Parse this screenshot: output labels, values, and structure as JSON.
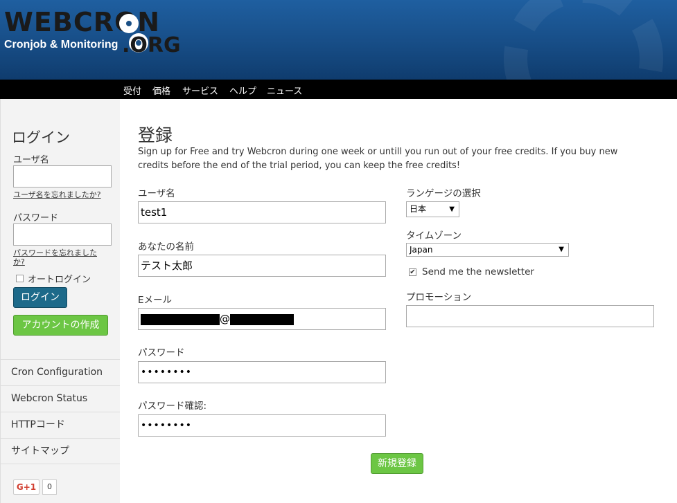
{
  "header": {
    "logo_main": "WEBCRON",
    "logo_sub": "Cronjob & Monitoring",
    "logo_org": ".ORG"
  },
  "nav": [
    "受付",
    "価格",
    "サービス",
    "ヘルプ",
    "ニュース"
  ],
  "sidebar": {
    "title": "ログイン",
    "username_label": "ユーザ名",
    "forgot_username": "ユーザ名を忘れましたか?",
    "password_label": "パスワード",
    "forgot_password": "パスワードを忘れましたか?",
    "autologin_label": "オートログイン",
    "login_button": "ログイン",
    "create_account_button": "アカウントの作成",
    "menu": [
      "Cron Configuration",
      "Webcron Status",
      "HTTPコード",
      "サイトマップ"
    ],
    "gplus_label": "G+1",
    "gplus_count": "0"
  },
  "main": {
    "title": "登録",
    "intro": "Sign up for Free and try Webcron during one week or untill you run out of your free credits. If you buy new credits before the end of the trial period, you can keep the free credits!",
    "username_label": "ユーザ名",
    "username_value": "test1",
    "name_label": "あなたの名前",
    "name_value": "テスト太郎",
    "email_label": "Eメール",
    "email_at": "@",
    "password_label": "パスワード",
    "password_value": "••••••••",
    "password_confirm_label": "パスワード確認:",
    "password_confirm_value": "••••••••",
    "language_label": "ランゲージの選択",
    "language_value": "日本",
    "timezone_label": "タイムゾーン",
    "timezone_value": "Japan",
    "newsletter_label": "Send me the newsletter",
    "promotion_label": "プロモーション",
    "promotion_value": "",
    "register_button": "新規登録"
  }
}
